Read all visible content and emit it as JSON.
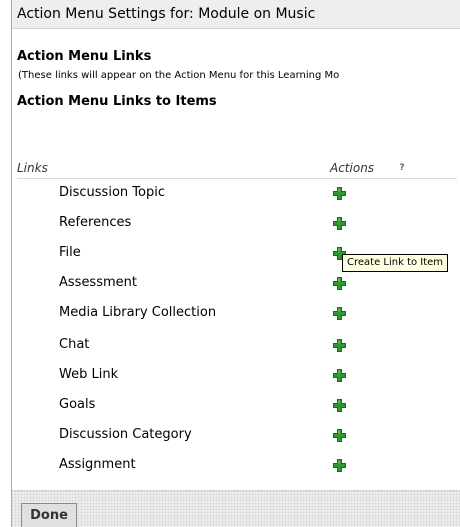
{
  "page": {
    "title": "Action Menu Settings for: Module on Music"
  },
  "sections": {
    "links_heading": "Action Menu Links",
    "links_note": "(These links will appear on the Action Menu for this Learning Mo",
    "items_heading": "Action Menu Links to Items"
  },
  "table": {
    "col_links": "Links",
    "col_actions": "Actions",
    "help_label": "?",
    "rows": [
      {
        "label": "Discussion Topic",
        "action_icon": "add-icon"
      },
      {
        "label": "References",
        "action_icon": "add-icon"
      },
      {
        "label": "File",
        "action_icon": "add-icon"
      },
      {
        "label": "Assessment",
        "action_icon": "add-icon"
      },
      {
        "label": "Media Library Collection",
        "action_icon": "add-icon"
      },
      {
        "label": "Chat",
        "action_icon": "add-icon"
      },
      {
        "label": "Web Link",
        "action_icon": "add-icon"
      },
      {
        "label": "Goals",
        "action_icon": "add-icon"
      },
      {
        "label": "Discussion Category",
        "action_icon": "add-icon"
      },
      {
        "label": "Assignment",
        "action_icon": "add-icon"
      }
    ]
  },
  "tooltip": {
    "text": "Create Link to Item"
  },
  "footer": {
    "done_label": "Done"
  },
  "colors": {
    "plus_green": "#2e9a2e",
    "plus_highlight": "#8fd98f",
    "title_bar": "#eeeeee",
    "tooltip_bg": "#ffffe1"
  }
}
